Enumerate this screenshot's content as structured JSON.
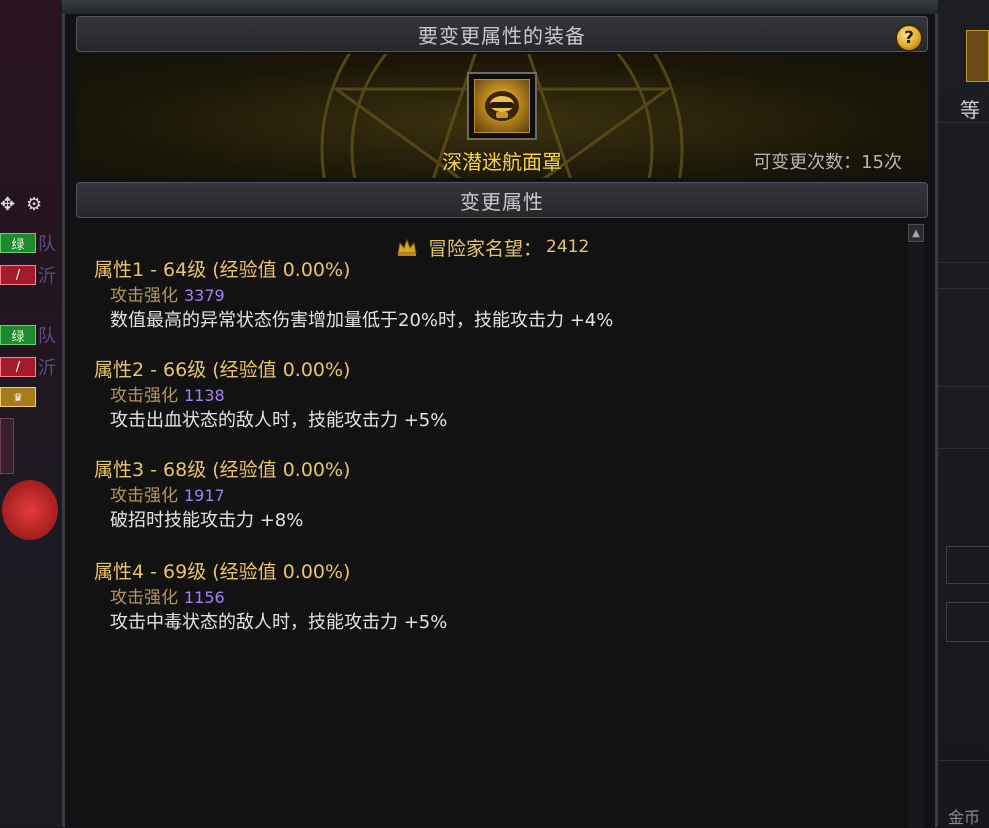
{
  "window": {
    "title": "要变更属性的装备",
    "section_title": "变更属性",
    "help_label": "?"
  },
  "equipment": {
    "name": "深潜迷航面罩",
    "change_count_text": "可变更次数：15次",
    "icon": "diving-mask-icon"
  },
  "fame": {
    "label": "冒险家名望：",
    "value": "2412",
    "icon": "fame-crown-icon"
  },
  "attributes": [
    {
      "header": "属性1 - 64级 (经验值 0.00%)",
      "stat_label": "攻击强化",
      "stat_value": "3379",
      "effect": "数值最高的异常状态伤害增加量低于20%时，技能攻击力 +4%"
    },
    {
      "header": "属性2 - 66级 (经验值 0.00%)",
      "stat_label": "攻击强化",
      "stat_value": "1138",
      "effect": "攻击出血状态的敌人时，技能攻击力 +5%"
    },
    {
      "header": "属性3 - 68级 (经验值 0.00%)",
      "stat_label": "攻击强化",
      "stat_value": "1917",
      "effect": "破招时技能攻击力 +8%"
    },
    {
      "header": "属性4 - 69级 (经验值 0.00%)",
      "stat_label": "攻击强化",
      "stat_value": "1156",
      "effect": "攻击中毒状态的敌人时，技能攻击力 +5%"
    }
  ],
  "left_hud": {
    "tags": [
      "绿",
      "绿"
    ],
    "side_texts": [
      "队",
      "沂",
      "队",
      "沂"
    ]
  },
  "right_edge": {
    "fragment_text": "等",
    "bottom_text": "金币"
  },
  "colors": {
    "gold": "#e9c46a",
    "item_name": "#f5d24a",
    "stat_value": "#a781f0",
    "panel_bg": "#121212"
  }
}
